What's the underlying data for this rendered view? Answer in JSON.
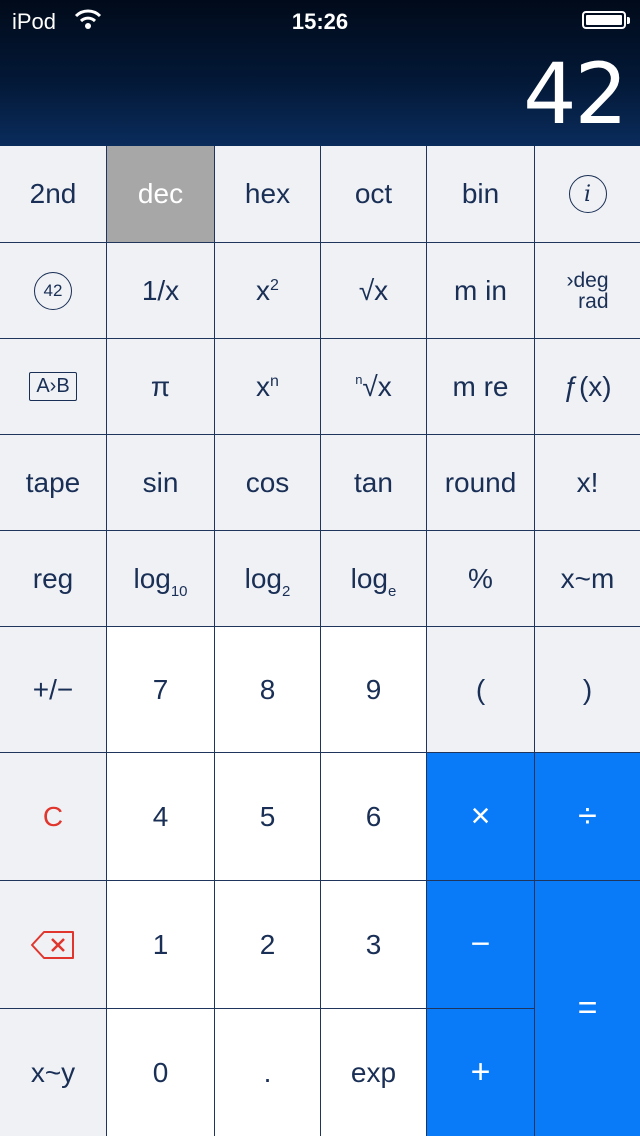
{
  "status_bar": {
    "carrier": "iPod",
    "time": "15:26",
    "battery_level": 1.0
  },
  "display": {
    "value": "42"
  },
  "keys": {
    "second": "2nd",
    "dec": "dec",
    "hex": "hex",
    "oct": "oct",
    "bin": "bin",
    "info": "i",
    "answer": "42",
    "reciprocal": "1/x",
    "x_squared": "x",
    "x_squared_sup": "2",
    "sqrt": "√x",
    "m_in": "m in",
    "deg_rad_top": "›deg",
    "deg_rad_bottom": "rad",
    "a_to_b": "A›B",
    "pi": "π",
    "x_power": "x",
    "x_power_sup": "n",
    "nth_root_sup": "n",
    "nth_root": "√x",
    "m_re": "m re",
    "func": "ƒ(x)",
    "tape": "tape",
    "sin": "sin",
    "cos": "cos",
    "tan": "tan",
    "round": "round",
    "factorial": "x!",
    "reg": "reg",
    "log10": "log",
    "log10_sub": "10",
    "log2": "log",
    "log2_sub": "2",
    "loge": "log",
    "loge_sub": "e",
    "percent": "%",
    "x_m": "x~m",
    "plus_minus": "+/−",
    "seven": "7",
    "eight": "8",
    "nine": "9",
    "open_paren": "(",
    "close_paren": ")",
    "clear": "C",
    "four": "4",
    "five": "5",
    "six": "6",
    "multiply": "×",
    "divide": "÷",
    "one": "1",
    "two": "2",
    "three": "3",
    "minus": "−",
    "x_y": "x~y",
    "zero": "0",
    "dot": ".",
    "exp": "exp",
    "plus": "+",
    "equals": "="
  },
  "colors": {
    "operator_blue": "#0a7bf8",
    "selected_gray": "#a7a7a7",
    "clear_red": "#e0362d",
    "text_navy": "#1a2f55"
  }
}
